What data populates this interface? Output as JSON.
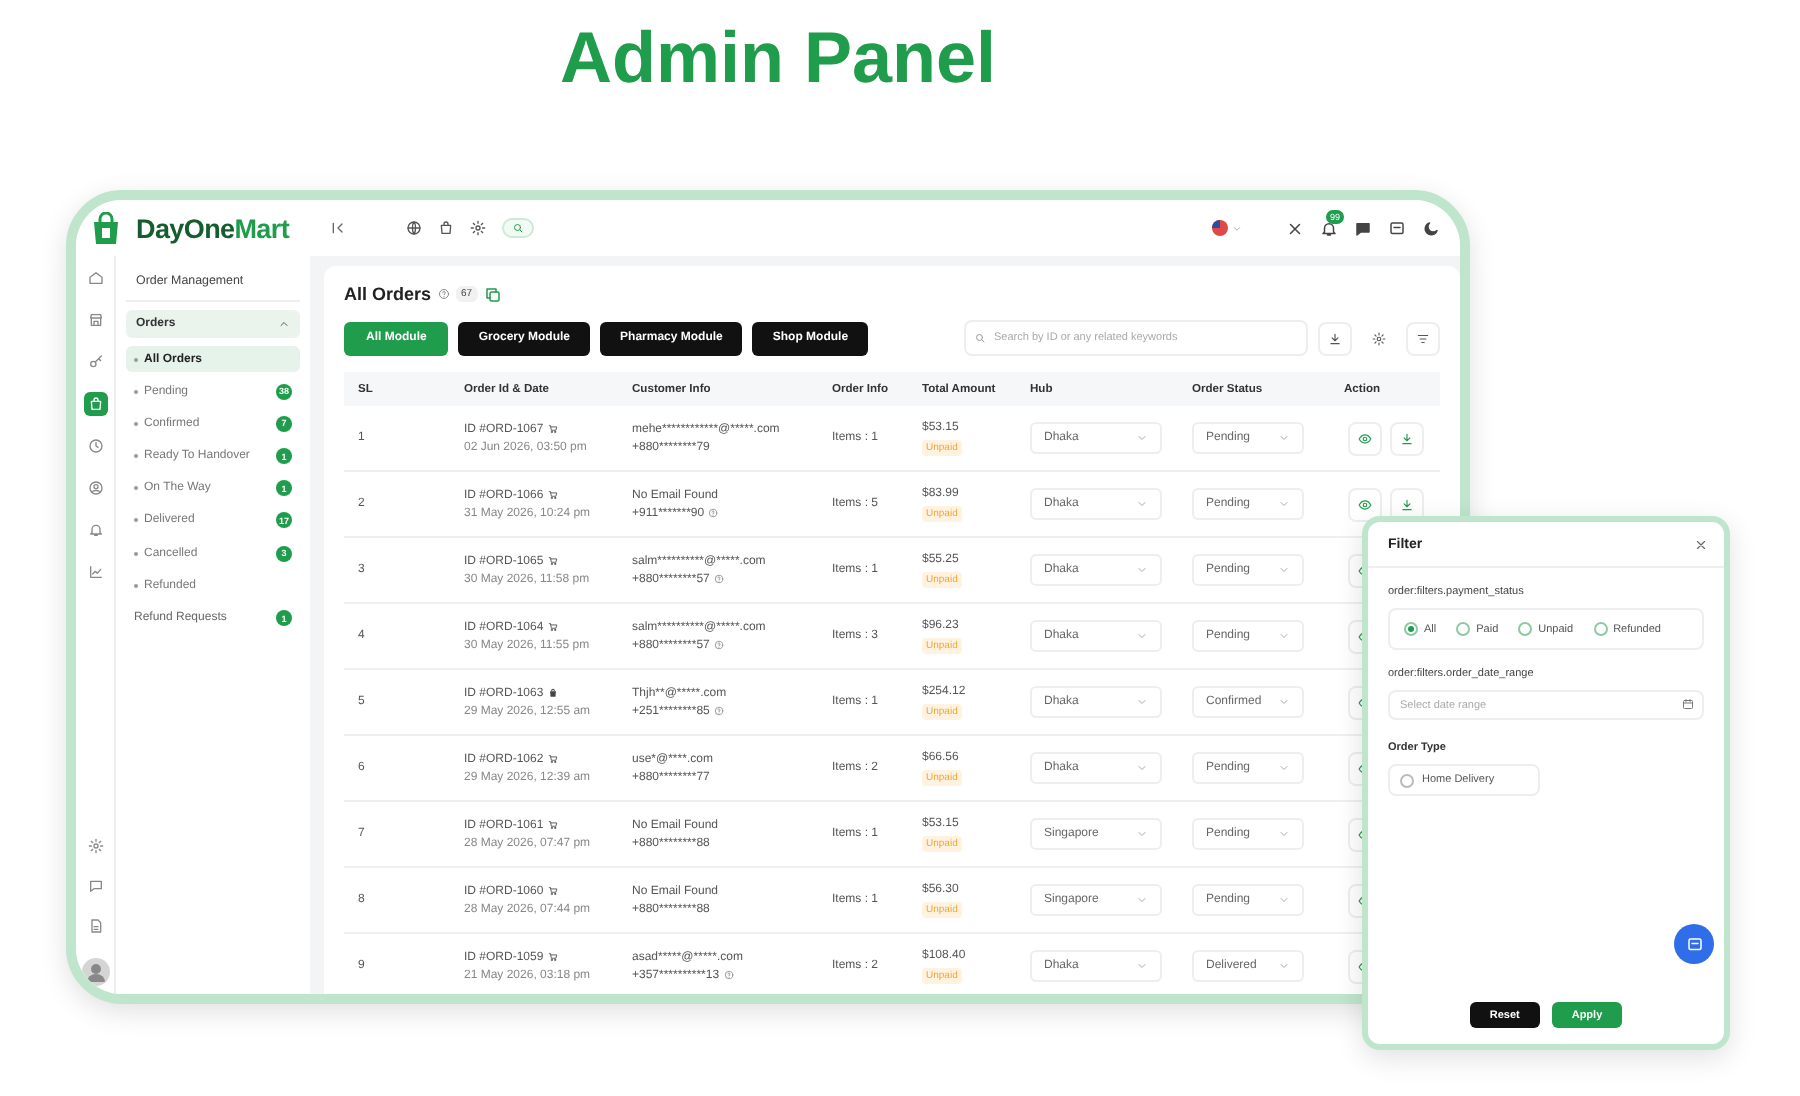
{
  "page_title": "Admin Panel",
  "brand": {
    "name": "**DayOne**Mart"
  },
  "topbar": {
    "notification_count": "99"
  },
  "rail": [
    {
      "selected": false
    },
    {
      "selected": false
    },
    {
      "selected": false
    },
    {
      "selected": true
    },
    {
      "selected": false
    },
    {
      "selected": false
    },
    {
      "selected": false
    },
    {
      "selected": false
    }
  ],
  "sidebar": {
    "heading": "Order Management",
    "group": {
      "label": "Orders",
      "expanded": true
    },
    "items": [
      {
        "label": "All Orders",
        "selected": true
      },
      {
        "label": "Pending",
        "count": "38",
        "selected": false
      },
      {
        "label": "Confirmed",
        "count": "7",
        "selected": false
      },
      {
        "label": "Ready To Handover",
        "count": "1",
        "selected": false
      },
      {
        "label": "On The Way",
        "count": "1",
        "selected": false
      },
      {
        "label": "Delivered",
        "count": "17",
        "selected": false
      },
      {
        "label": "Cancelled",
        "count": "3",
        "selected": false
      },
      {
        "label": "Refunded",
        "selected": false
      }
    ],
    "refund_requests": {
      "label": "Refund Requests",
      "count": "1"
    }
  },
  "main": {
    "title": "All Orders",
    "count": "67",
    "modules": [
      {
        "label": "All Module",
        "selected": true
      },
      {
        "label": "Grocery Module",
        "selected": false
      },
      {
        "label": "Pharmacy Module",
        "selected": false
      },
      {
        "label": "Shop Module",
        "selected": false
      }
    ],
    "search": {
      "placeholder": "Search by ID or any related keywords"
    },
    "table": {
      "columns": [
        "SL",
        "Order Id & Date",
        "Customer Info",
        "Order Info",
        "Total Amount",
        "Hub",
        "Order Status",
        "Action"
      ],
      "rows": [
        {
          "sl": "1",
          "order_id": "ID #ORD-1067",
          "kind": "cart",
          "date": "02 Jun 2026, 03:50 pm",
          "email": "mehe************@*****.com",
          "phone": "+880********79",
          "phone_note": false,
          "items": "Items : 1",
          "amount": "$53.15",
          "payment": "Unpaid",
          "hub": "Dhaka",
          "status": "Pending",
          "actions": [
            {
              "kind": "view"
            },
            {
              "kind": "download"
            }
          ]
        },
        {
          "sl": "2",
          "order_id": "ID #ORD-1066",
          "kind": "cart",
          "date": "31 May 2026, 10:24 pm",
          "email": "No Email Found",
          "phone": "+911*******90",
          "phone_note": true,
          "items": "Items : 5",
          "amount": "$83.99",
          "payment": "Unpaid",
          "hub": "Dhaka",
          "status": "Pending",
          "actions": [
            {
              "kind": "view"
            },
            {
              "kind": "download"
            }
          ]
        },
        {
          "sl": "3",
          "order_id": "ID #ORD-1065",
          "kind": "cart",
          "date": "30 May 2026, 11:58 pm",
          "email": "salm**********@*****.com",
          "phone": "+880********57",
          "phone_note": true,
          "items": "Items : 1",
          "amount": "$55.25",
          "payment": "Unpaid",
          "hub": "Dhaka",
          "status": "Pending",
          "actions": [
            {
              "kind": "view"
            }
          ]
        },
        {
          "sl": "4",
          "order_id": "ID #ORD-1064",
          "kind": "cart",
          "date": "30 May 2026, 11:55 pm",
          "email": "salm**********@*****.com",
          "phone": "+880********57",
          "phone_note": true,
          "items": "Items : 3",
          "amount": "$96.23",
          "payment": "Unpaid",
          "hub": "Dhaka",
          "status": "Pending",
          "actions": [
            {
              "kind": "view"
            }
          ]
        },
        {
          "sl": "5",
          "order_id": "ID #ORD-1063",
          "kind": "bag",
          "date": "29 May 2026, 12:55 am",
          "email": "Thjh**@*****.com",
          "phone": "+251********85",
          "phone_note": true,
          "items": "Items : 1",
          "amount": "$254.12",
          "payment": "Unpaid",
          "hub": "Dhaka",
          "status": "Confirmed",
          "actions": [
            {
              "kind": "view"
            }
          ]
        },
        {
          "sl": "6",
          "order_id": "ID #ORD-1062",
          "kind": "cart",
          "date": "29 May 2026, 12:39 am",
          "email": "use*@****.com",
          "phone": "+880********77",
          "phone_note": false,
          "items": "Items : 2",
          "amount": "$66.56",
          "payment": "Unpaid",
          "hub": "Dhaka",
          "status": "Pending",
          "actions": [
            {
              "kind": "view"
            }
          ]
        },
        {
          "sl": "7",
          "order_id": "ID #ORD-1061",
          "kind": "cart",
          "date": "28 May 2026, 07:47 pm",
          "email": "No Email Found",
          "phone": "+880********88",
          "phone_note": false,
          "items": "Items : 1",
          "amount": "$53.15",
          "payment": "Unpaid",
          "hub": "Singapore",
          "status": "Pending",
          "actions": [
            {
              "kind": "view"
            }
          ]
        },
        {
          "sl": "8",
          "order_id": "ID #ORD-1060",
          "kind": "cart",
          "date": "28 May 2026, 07:44 pm",
          "email": "No Email Found",
          "phone": "+880********88",
          "phone_note": false,
          "items": "Items : 1",
          "amount": "$56.30",
          "payment": "Unpaid",
          "hub": "Singapore",
          "status": "Pending",
          "actions": [
            {
              "kind": "view"
            }
          ]
        },
        {
          "sl": "9",
          "order_id": "ID #ORD-1059",
          "kind": "cart",
          "date": "21 May 2026, 03:18 pm",
          "email": "asad*****@*****.com",
          "phone": "+357**********13",
          "phone_note": true,
          "items": "Items : 2",
          "amount": "$108.40",
          "payment": "Unpaid",
          "hub": "Dhaka",
          "status": "Delivered",
          "actions": [
            {
              "kind": "view"
            }
          ]
        }
      ]
    }
  },
  "filter": {
    "title": "Filter",
    "payment_label": "order:filters.payment_status",
    "payment_options": [
      {
        "label": "All",
        "selected": true
      },
      {
        "label": "Paid",
        "selected": false
      },
      {
        "label": "Unpaid",
        "selected": false
      },
      {
        "label": "Refunded",
        "selected": false
      }
    ],
    "date_label": "order:filters.order_date_range",
    "date_placeholder": "Select date range",
    "order_type_label": "Order Type",
    "order_types": [
      {
        "label": "Home Delivery",
        "checked": false
      }
    ],
    "buttons": [
      {
        "label": "Reset",
        "kind": "secondary"
      },
      {
        "label": "Apply",
        "kind": "primary"
      }
    ]
  }
}
